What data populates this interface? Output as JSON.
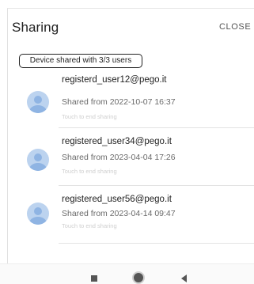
{
  "dialog": {
    "title": "Sharing",
    "close_label": "CLOSE"
  },
  "summary_badge": "Device shared with 3/3 users",
  "users": [
    {
      "email": "registerd_user12@pego.it",
      "shared": "Shared from 2022-10-07 16:37",
      "hint": "Touch to end sharing"
    },
    {
      "email": "registered_user34@pego.it",
      "shared": "Shared from 2023-04-04 17:26",
      "hint": "Touch to end sharing"
    },
    {
      "email": "registered_user56@pego.it",
      "shared": "Shared from 2023-04-14 09:47",
      "hint": "Touch to end sharing"
    }
  ],
  "navbar": {
    "icons": [
      "recents-icon",
      "home-icon",
      "back-icon"
    ]
  },
  "colors": {
    "avatar_bg": "#bcd3ef",
    "avatar_fg": "#8fb4e3",
    "hint_text": "#cfcfcf"
  }
}
